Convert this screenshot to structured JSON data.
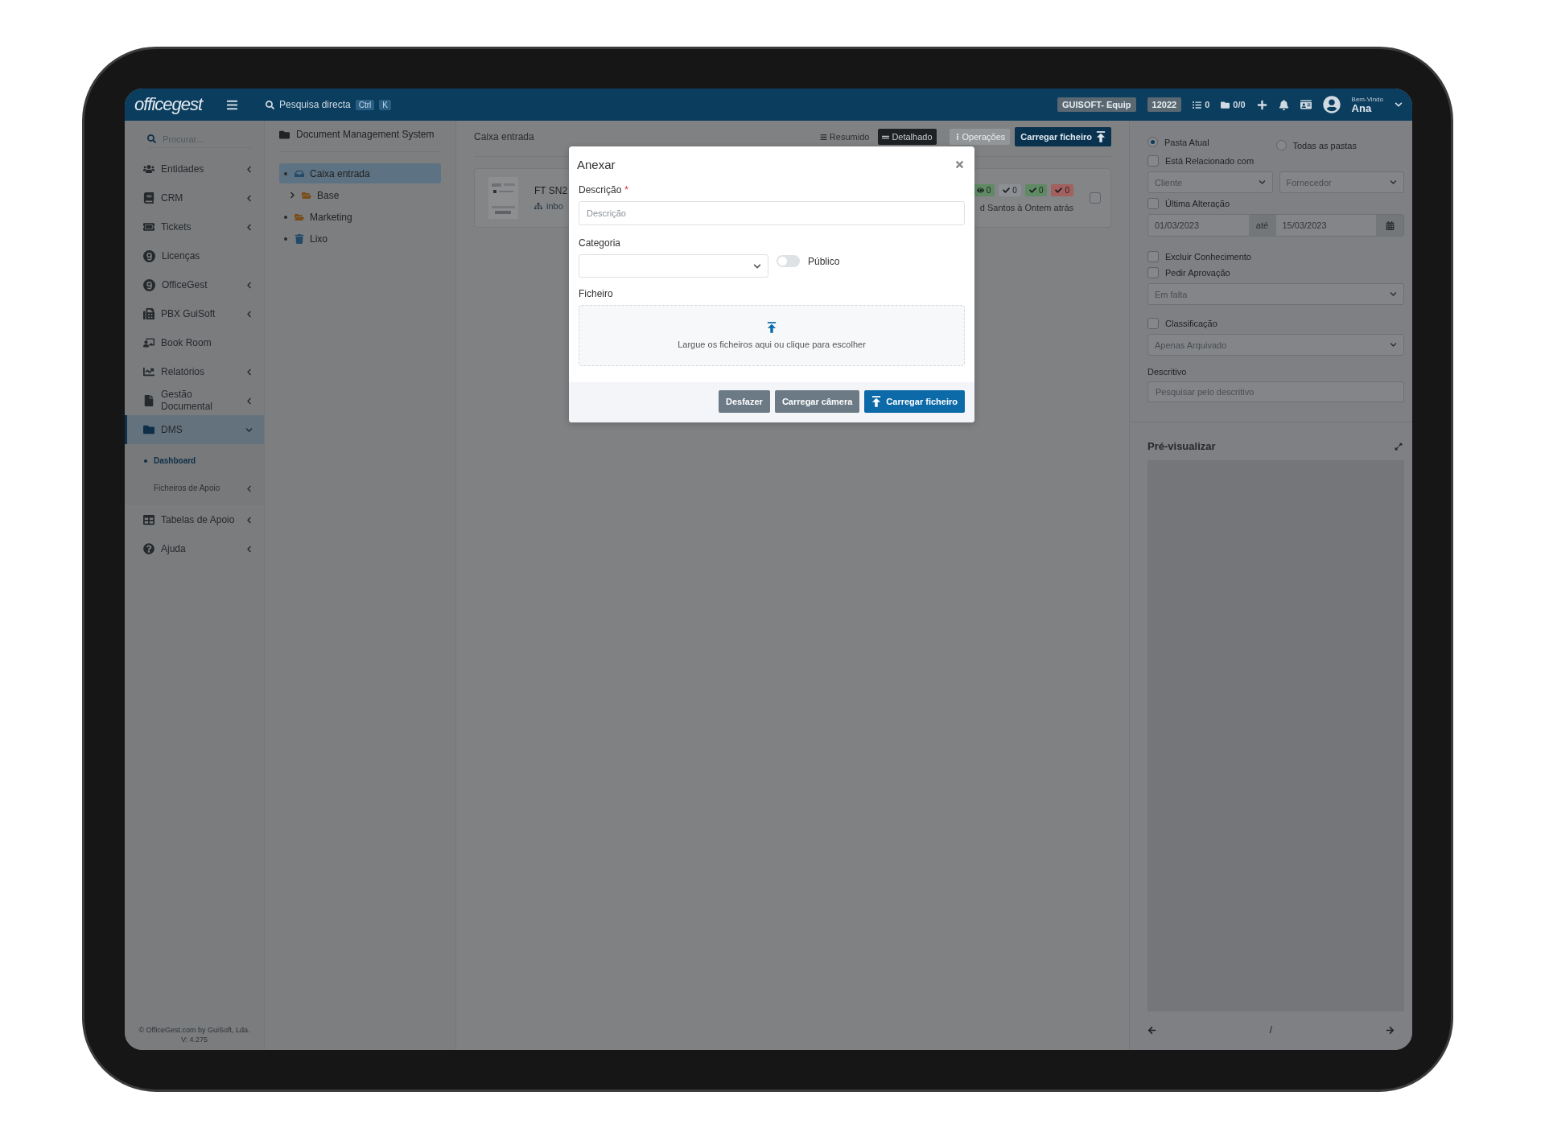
{
  "topbar": {
    "logo": "officegest",
    "search": {
      "label": "Pesquisa directa",
      "keys": [
        "Ctrl",
        "K"
      ]
    },
    "badges": [
      "GUISOFT- Equip",
      "12022"
    ],
    "counters": [
      {
        "kind": "list",
        "text": "0"
      },
      {
        "kind": "folder",
        "text": "0/0"
      }
    ],
    "greeting": "Bem-Vindo",
    "user": "Ana"
  },
  "sidebar": {
    "search_placeholder": "Procurar...",
    "items": [
      {
        "label": "Entidades",
        "expandable": true,
        "expanded": false,
        "selected": false
      },
      {
        "label": "CRM",
        "expandable": true,
        "expanded": false,
        "selected": false
      },
      {
        "label": "Tickets",
        "expandable": true,
        "expanded": false,
        "selected": false
      },
      {
        "label": "Licenças",
        "expandable": false,
        "selected": false
      },
      {
        "label": "OfficeGest",
        "expandable": true,
        "expanded": false,
        "selected": false
      },
      {
        "label": "PBX GuiSoft",
        "expandable": true,
        "expanded": false,
        "selected": false
      },
      {
        "label": "Book Room",
        "expandable": false,
        "selected": false
      },
      {
        "label": "Relatórios",
        "expandable": true,
        "expanded": false,
        "selected": false
      },
      {
        "label": "Gestão Documental",
        "expandable": true,
        "expanded": false,
        "selected": false
      },
      {
        "label": "DMS",
        "expandable": true,
        "expanded": true,
        "selected": true,
        "children": [
          {
            "label": "Dashboard",
            "selected": true,
            "expandable": false
          },
          {
            "label": "Ficheiros de Apoio",
            "selected": false,
            "expandable": true
          }
        ]
      },
      {
        "label": "Tabelas de Apoio",
        "expandable": true,
        "expanded": false,
        "selected": false
      },
      {
        "label": "Ajuda",
        "expandable": true,
        "expanded": false,
        "selected": false
      }
    ],
    "footer": [
      "© OfficeGest.com  by  GuiSoft, Lda.",
      "V: 4.275"
    ]
  },
  "tree": {
    "title": "Document Management System",
    "nodes": [
      {
        "label": "Caixa entrada",
        "kind": "inbox",
        "selected": true,
        "children": [
          {
            "label": "Base",
            "kind": "folder",
            "selected": false,
            "expanded": false
          }
        ]
      },
      {
        "label": "Marketing",
        "kind": "folder",
        "selected": false
      },
      {
        "label": "Lixo",
        "kind": "trash",
        "selected": false
      }
    ]
  },
  "main": {
    "title": "Caixa entrada",
    "view_buttons": [
      {
        "label": "Resumido",
        "selected": false
      },
      {
        "label": "Detalhado",
        "selected": true
      }
    ],
    "operations": {
      "label": "Operações",
      "disabled": true
    },
    "upload_button": "Carregar ficheiro",
    "document": {
      "title": "FT SN2",
      "folder": "inbo",
      "meta": "d Santos à Ontem atrás",
      "checked": false,
      "counters": [
        {
          "kind": "views",
          "text": "0",
          "color": "#5f8a63"
        },
        {
          "kind": "check",
          "text": "0",
          "color": "#8c9095"
        },
        {
          "kind": "check",
          "text": "0",
          "color": "#5f8a63"
        },
        {
          "kind": "check",
          "text": "0",
          "color": "#a3605e"
        }
      ]
    }
  },
  "filters": {
    "scope": [
      {
        "label": "Pasta Atual",
        "selected": true
      },
      {
        "label": "Todas as pastas",
        "selected": false
      }
    ],
    "related": {
      "label": "Está Relacionado com",
      "checked": false,
      "selects": [
        "Cliente",
        "Fornecedor"
      ]
    },
    "last_change": {
      "label": "Última Alteração",
      "checked": false,
      "from": "01/03/2023",
      "separator": "até",
      "to": "15/03/2023"
    },
    "exclude": {
      "label": "Excluir Conhecimento",
      "checked": false
    },
    "approval": {
      "label": "Pedir Aprovação",
      "checked": false,
      "select": "Em falta"
    },
    "classification": {
      "label": "Classificação",
      "checked": false,
      "select": "Apenas Arquivado"
    },
    "descriptive": {
      "label": "Descritivo",
      "placeholder": "Pesquisar pelo descritivo"
    }
  },
  "preview": {
    "title": "Pré-visualizar",
    "pager": "/"
  },
  "modal": {
    "title": "Anexar",
    "description": {
      "label": "Descrição",
      "required_mark": "*",
      "placeholder": "Descrição"
    },
    "category": {
      "label": "Categoria"
    },
    "public": {
      "label": "Público",
      "on": false
    },
    "file": {
      "label": "Ficheiro",
      "dropzone": "Largue os ficheiros aqui ou clique para escolher"
    },
    "buttons": [
      {
        "kind": "secondary",
        "label": "Desfazer"
      },
      {
        "kind": "secondary",
        "label": "Carregar câmera"
      },
      {
        "kind": "primary",
        "label": "Carregar ficheiro"
      }
    ]
  }
}
